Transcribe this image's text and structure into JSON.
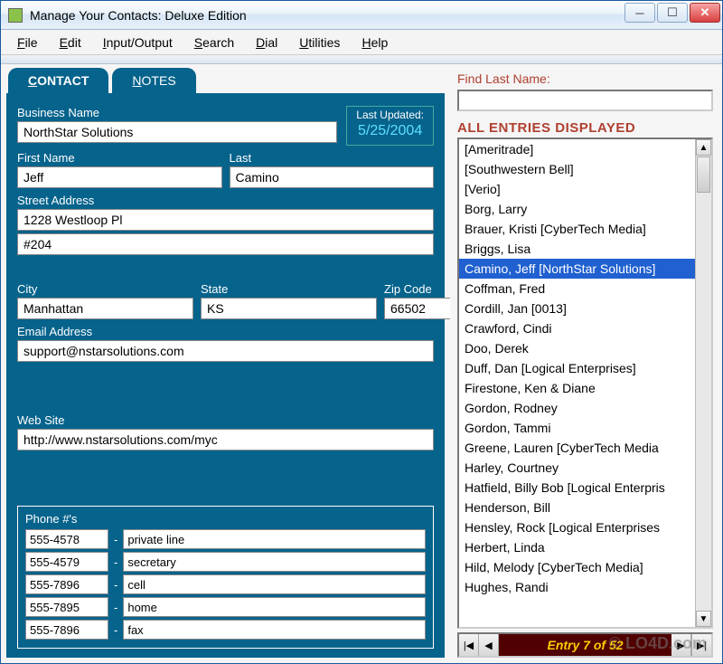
{
  "window": {
    "title": "Manage Your Contacts: Deluxe Edition"
  },
  "menu": [
    "File",
    "Edit",
    "Input/Output",
    "Search",
    "Dial",
    "Utilities",
    "Help"
  ],
  "tabs": {
    "contact": "CONTACT",
    "notes": "NOTES"
  },
  "form": {
    "business_label": "Business Name",
    "business": "NorthStar Solutions",
    "last_updated_label": "Last Updated:",
    "last_updated": "5/25/2004",
    "first_label": "First Name",
    "first": "Jeff",
    "last_label": "Last",
    "last": "Camino",
    "street_label": "Street Address",
    "street1": "1228 Westloop Pl",
    "street2": "#204",
    "city_label": "City",
    "city": "Manhattan",
    "state_label": "State",
    "state": "KS",
    "zip_label": "Zip Code",
    "zip": "66502",
    "email_label": "Email Address",
    "email": "support@nstarsolutions.com",
    "web_label": "Web Site",
    "web": "http://www.nstarsolutions.com/myc",
    "phone_label": "Phone #'s",
    "phones": [
      {
        "num": "555-4578",
        "desc": "private line"
      },
      {
        "num": "555-4579",
        "desc": "secretary"
      },
      {
        "num": "555-7896",
        "desc": "cell"
      },
      {
        "num": "555-7895",
        "desc": "home"
      },
      {
        "num": "555-7896",
        "desc": "fax"
      }
    ]
  },
  "right": {
    "find_label": "Find Last Name:",
    "find_value": "",
    "all_entries": "ALL ENTRIES DISPLAYED",
    "entries": [
      "[Ameritrade]",
      "[Southwestern Bell]",
      "[Verio]",
      "Borg, Larry",
      "Brauer, Kristi [CyberTech Media]",
      "Briggs, Lisa",
      "Camino, Jeff [NorthStar Solutions]",
      "Coffman, Fred",
      "Cordill, Jan [0013]",
      "Crawford, Cindi",
      "Doo, Derek",
      "Duff, Dan [Logical Enterprises]",
      "Firestone, Ken & Diane",
      "Gordon, Rodney",
      "Gordon, Tammi",
      "Greene, Lauren [CyberTech Media",
      "Harley, Courtney",
      "Hatfield, Billy Bob [Logical Enterpris",
      "Henderson, Bill",
      "Hensley, Rock [Logical Enterprises",
      "Herbert, Linda",
      "Hild, Melody [CyberTech Media]",
      "Hughes, Randi"
    ],
    "selected_index": 6,
    "pager": "Entry 7 of 52"
  },
  "watermark": "© LO4D.com"
}
